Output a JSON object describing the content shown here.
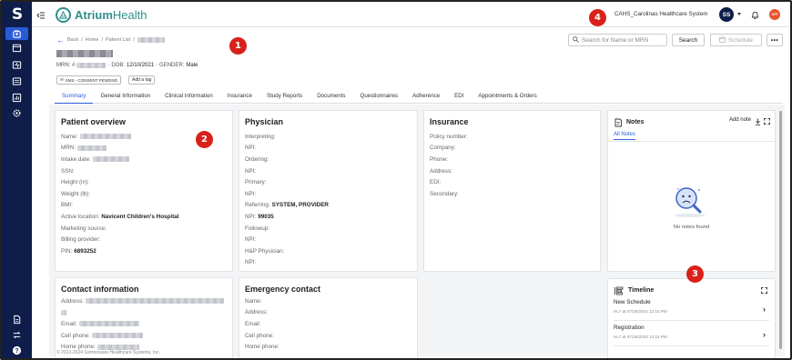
{
  "app": {
    "rail_logo": "S",
    "brand_name": "Atrium",
    "brand_suffix": "Health",
    "org_name": "CAHS_Carolinas Healthcare System",
    "user_initials": "SS",
    "status_badge": "OFF",
    "rail_icons": [
      "patients-icon",
      "calendar-icon",
      "monitor-icon",
      "imaging-icon",
      "reports-icon",
      "settings-icon"
    ],
    "rail_bottom_icons": [
      "document-icon",
      "transfer-icon",
      "help-icon"
    ]
  },
  "header": {
    "breadcrumb": {
      "back": "Back",
      "home": "Home",
      "patient_list": "Patient List"
    },
    "demographics": {
      "mrn_label": "MRN: #",
      "dob_label": "DOB:",
      "dob": "12/10/2021",
      "gender_label": "GENDER:",
      "gender": "Male"
    },
    "tag_badge": "SMS - CONSENT PENDING",
    "add_tag": "Add a tag",
    "search_placeholder": "Search for Name or MRN",
    "search_button": "Search",
    "schedule_button": "Schedule",
    "more_button": "•••"
  },
  "tabs": [
    {
      "label": "Summary",
      "active": true
    },
    {
      "label": "General Information"
    },
    {
      "label": "Clinical Information"
    },
    {
      "label": "Insurance"
    },
    {
      "label": "Study Reports"
    },
    {
      "label": "Documents"
    },
    {
      "label": "Questionnaires"
    },
    {
      "label": "Adherence"
    },
    {
      "label": "EDI"
    },
    {
      "label": "Appointments & Orders"
    }
  ],
  "patient_overview": {
    "title": "Patient overview",
    "fields": {
      "name": "Name:",
      "mrn": "MRN:",
      "intake": "Intake date:",
      "ssn": "SSN:",
      "height": "Height (in):",
      "weight": "Weight (lb):",
      "bmi": "BMI:",
      "active_location": "Active location:",
      "active_location_value": "Navicent Children's Hospital",
      "marketing": "Marketing source:",
      "billing": "Billing provider:",
      "pin": "PIN:",
      "pin_value": "6893252"
    }
  },
  "physician": {
    "title": "Physician",
    "fields": {
      "interpreting": "Interpreting:",
      "npi1": "NPI:",
      "ordering": "Ordering:",
      "npi2": "NPI:",
      "primary": "Primary:",
      "npi3": "NPI:",
      "referring": "Referring:",
      "referring_value": "SYSTEM, PROVIDER",
      "npi4": "NPI:",
      "npi4_value": "99035",
      "followup": "Followup:",
      "npi5": "NPI:",
      "hp": "H&P Physician:",
      "npi6": "NPI:"
    }
  },
  "insurance": {
    "title": "Insurance",
    "fields": {
      "policy": "Policy number:",
      "company": "Company:",
      "phone": "Phone:",
      "address": "Address:",
      "edi": "EDI:",
      "secondary": "Secondary:"
    }
  },
  "contact": {
    "title": "Contact information",
    "fields": {
      "address": "Address:",
      "email": "Email:",
      "cell": "Cell phone:",
      "home": "Home phone:"
    }
  },
  "emergency": {
    "title": "Emergency contact",
    "fields": {
      "name": "Name:",
      "address": "Address:",
      "email": "Email:",
      "cell": "Cell phone:",
      "home": "Home phone:"
    }
  },
  "notes": {
    "title": "Notes",
    "add_label": "Add note",
    "tab": "All Notes",
    "empty": "No notes found"
  },
  "timeline": {
    "title": "Timeline",
    "items": [
      {
        "title": "New Schedule",
        "sub": "HL7 at 07/25/2024 12:15 PM"
      },
      {
        "title": "Registration",
        "sub": "HL7 at 07/25/2024 12:15 PM"
      }
    ]
  },
  "footer": {
    "copyright": "© 2013-2024 Somnoware Healthcare Systems, Inc."
  },
  "callouts": [
    "1",
    "2",
    "3",
    "4"
  ],
  "colors": {
    "rail": "#0f1d4a",
    "accent": "#2a5bd7",
    "brand": "#2f8f8b",
    "callout": "#d9211b",
    "status": "#e8542a"
  }
}
